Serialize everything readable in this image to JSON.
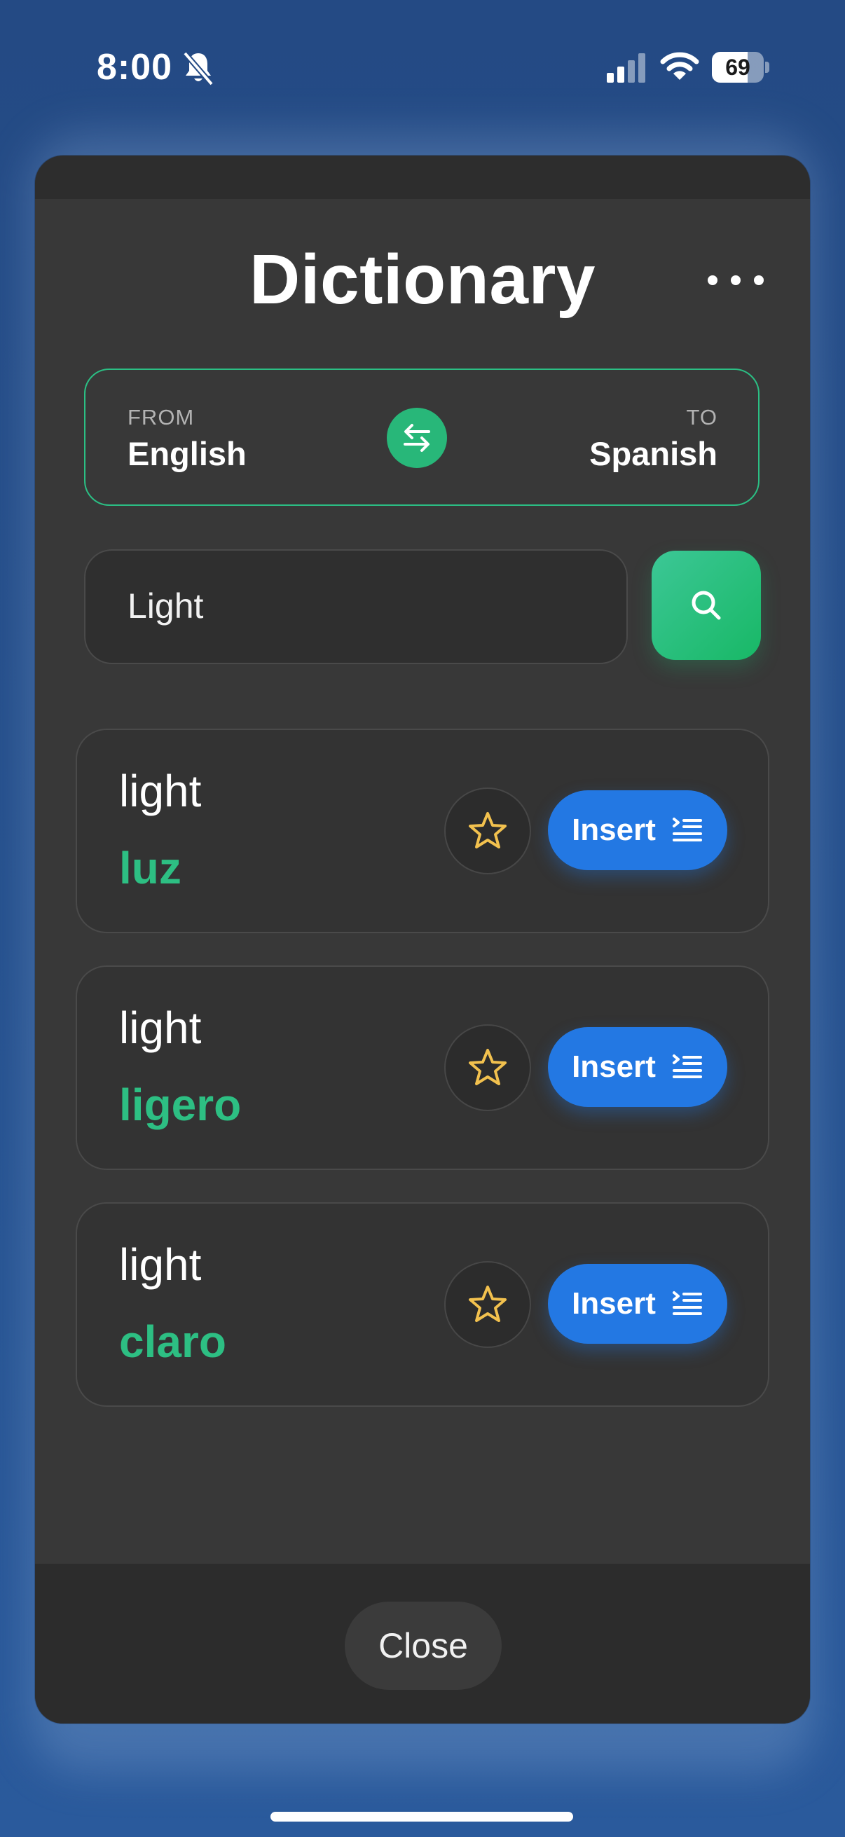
{
  "status_bar": {
    "time": "8:00",
    "battery": "69",
    "battery_level": 0.69,
    "icons": [
      "bell-slash-icon",
      "cellular-signal-icon",
      "wifi-icon",
      "battery-icon"
    ]
  },
  "header": {
    "title": "Dictionary",
    "more_icon": "ellipsis-icon"
  },
  "languages": {
    "from_label": "FROM",
    "from": "English",
    "to_label": "TO",
    "to": "Spanish",
    "swap_icon": "swap-arrows-icon",
    "accent_color": "#2bbf84"
  },
  "search": {
    "value": "Light",
    "button_icon": "search-icon",
    "button_color": "#28b779"
  },
  "results": [
    {
      "word": "light",
      "translation": "luz",
      "favorite_icon": "star-icon",
      "insert_label": "Insert",
      "insert_icon": "insert-list-icon"
    },
    {
      "word": "light",
      "translation": "ligero",
      "favorite_icon": "star-icon",
      "insert_label": "Insert",
      "insert_icon": "insert-list-icon"
    },
    {
      "word": "light",
      "translation": "claro",
      "favorite_icon": "star-icon",
      "insert_label": "Insert",
      "insert_icon": "insert-list-icon"
    }
  ],
  "colors": {
    "translation": "#2dbf83",
    "insert_button": "#2378e3",
    "star": "#f2c14e"
  },
  "footer": {
    "close_label": "Close"
  }
}
